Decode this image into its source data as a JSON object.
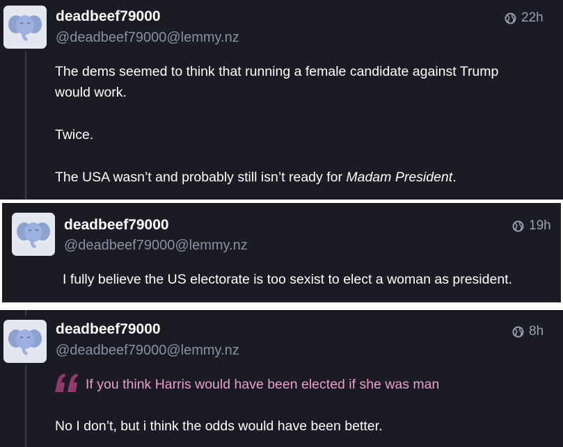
{
  "comments": [
    {
      "username": "deadbeef79000",
      "handle": "@deadbeef79000@lemmy.nz",
      "time": "22h",
      "paragraphs": [
        {
          "line1": "The dems seemed to think that running a female candidate against Trump",
          "line2": "would work."
        },
        {
          "text": "Twice."
        },
        {
          "prefix": "The USA wasn’t and probably still isn’t ready for ",
          "emphasis": "Madam President",
          "suffix": "."
        }
      ]
    },
    {
      "username": "deadbeef79000",
      "handle": "@deadbeef79000@lemmy.nz",
      "time": "19h",
      "paragraphs": [
        {
          "text": "I fully believe the US electorate is too sexist to elect a woman as president."
        }
      ]
    },
    {
      "username": "deadbeef79000",
      "handle": "@deadbeef79000@lemmy.nz",
      "time": "8h",
      "quote": "If you think Harris would have been elected if she was man",
      "paragraphs": [
        {
          "text": "No I don’t,  but i think the odds would have been better."
        }
      ]
    }
  ],
  "colors": {
    "background": "#1b1b24",
    "username": "#ffffff",
    "handle": "#8c8fa3",
    "quote_text": "#ea9fd0",
    "quote_mark": "#8e3a6e"
  },
  "icons": {
    "avatar": "elephant-avatar-icon",
    "time": "globe-icon",
    "quote": "quote-mark-icon"
  }
}
